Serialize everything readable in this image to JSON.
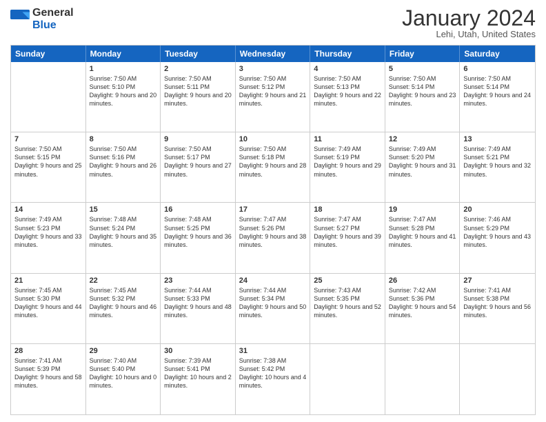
{
  "logo": {
    "general": "General",
    "blue": "Blue"
  },
  "title": "January 2024",
  "location": "Lehi, Utah, United States",
  "days": [
    "Sunday",
    "Monday",
    "Tuesday",
    "Wednesday",
    "Thursday",
    "Friday",
    "Saturday"
  ],
  "weeks": [
    [
      {
        "num": "",
        "sunrise": "",
        "sunset": "",
        "daylight": ""
      },
      {
        "num": "1",
        "sunrise": "Sunrise: 7:50 AM",
        "sunset": "Sunset: 5:10 PM",
        "daylight": "Daylight: 9 hours and 20 minutes."
      },
      {
        "num": "2",
        "sunrise": "Sunrise: 7:50 AM",
        "sunset": "Sunset: 5:11 PM",
        "daylight": "Daylight: 9 hours and 20 minutes."
      },
      {
        "num": "3",
        "sunrise": "Sunrise: 7:50 AM",
        "sunset": "Sunset: 5:12 PM",
        "daylight": "Daylight: 9 hours and 21 minutes."
      },
      {
        "num": "4",
        "sunrise": "Sunrise: 7:50 AM",
        "sunset": "Sunset: 5:13 PM",
        "daylight": "Daylight: 9 hours and 22 minutes."
      },
      {
        "num": "5",
        "sunrise": "Sunrise: 7:50 AM",
        "sunset": "Sunset: 5:14 PM",
        "daylight": "Daylight: 9 hours and 23 minutes."
      },
      {
        "num": "6",
        "sunrise": "Sunrise: 7:50 AM",
        "sunset": "Sunset: 5:14 PM",
        "daylight": "Daylight: 9 hours and 24 minutes."
      }
    ],
    [
      {
        "num": "7",
        "sunrise": "Sunrise: 7:50 AM",
        "sunset": "Sunset: 5:15 PM",
        "daylight": "Daylight: 9 hours and 25 minutes."
      },
      {
        "num": "8",
        "sunrise": "Sunrise: 7:50 AM",
        "sunset": "Sunset: 5:16 PM",
        "daylight": "Daylight: 9 hours and 26 minutes."
      },
      {
        "num": "9",
        "sunrise": "Sunrise: 7:50 AM",
        "sunset": "Sunset: 5:17 PM",
        "daylight": "Daylight: 9 hours and 27 minutes."
      },
      {
        "num": "10",
        "sunrise": "Sunrise: 7:50 AM",
        "sunset": "Sunset: 5:18 PM",
        "daylight": "Daylight: 9 hours and 28 minutes."
      },
      {
        "num": "11",
        "sunrise": "Sunrise: 7:49 AM",
        "sunset": "Sunset: 5:19 PM",
        "daylight": "Daylight: 9 hours and 29 minutes."
      },
      {
        "num": "12",
        "sunrise": "Sunrise: 7:49 AM",
        "sunset": "Sunset: 5:20 PM",
        "daylight": "Daylight: 9 hours and 31 minutes."
      },
      {
        "num": "13",
        "sunrise": "Sunrise: 7:49 AM",
        "sunset": "Sunset: 5:21 PM",
        "daylight": "Daylight: 9 hours and 32 minutes."
      }
    ],
    [
      {
        "num": "14",
        "sunrise": "Sunrise: 7:49 AM",
        "sunset": "Sunset: 5:23 PM",
        "daylight": "Daylight: 9 hours and 33 minutes."
      },
      {
        "num": "15",
        "sunrise": "Sunrise: 7:48 AM",
        "sunset": "Sunset: 5:24 PM",
        "daylight": "Daylight: 9 hours and 35 minutes."
      },
      {
        "num": "16",
        "sunrise": "Sunrise: 7:48 AM",
        "sunset": "Sunset: 5:25 PM",
        "daylight": "Daylight: 9 hours and 36 minutes."
      },
      {
        "num": "17",
        "sunrise": "Sunrise: 7:47 AM",
        "sunset": "Sunset: 5:26 PM",
        "daylight": "Daylight: 9 hours and 38 minutes."
      },
      {
        "num": "18",
        "sunrise": "Sunrise: 7:47 AM",
        "sunset": "Sunset: 5:27 PM",
        "daylight": "Daylight: 9 hours and 39 minutes."
      },
      {
        "num": "19",
        "sunrise": "Sunrise: 7:47 AM",
        "sunset": "Sunset: 5:28 PM",
        "daylight": "Daylight: 9 hours and 41 minutes."
      },
      {
        "num": "20",
        "sunrise": "Sunrise: 7:46 AM",
        "sunset": "Sunset: 5:29 PM",
        "daylight": "Daylight: 9 hours and 43 minutes."
      }
    ],
    [
      {
        "num": "21",
        "sunrise": "Sunrise: 7:45 AM",
        "sunset": "Sunset: 5:30 PM",
        "daylight": "Daylight: 9 hours and 44 minutes."
      },
      {
        "num": "22",
        "sunrise": "Sunrise: 7:45 AM",
        "sunset": "Sunset: 5:32 PM",
        "daylight": "Daylight: 9 hours and 46 minutes."
      },
      {
        "num": "23",
        "sunrise": "Sunrise: 7:44 AM",
        "sunset": "Sunset: 5:33 PM",
        "daylight": "Daylight: 9 hours and 48 minutes."
      },
      {
        "num": "24",
        "sunrise": "Sunrise: 7:44 AM",
        "sunset": "Sunset: 5:34 PM",
        "daylight": "Daylight: 9 hours and 50 minutes."
      },
      {
        "num": "25",
        "sunrise": "Sunrise: 7:43 AM",
        "sunset": "Sunset: 5:35 PM",
        "daylight": "Daylight: 9 hours and 52 minutes."
      },
      {
        "num": "26",
        "sunrise": "Sunrise: 7:42 AM",
        "sunset": "Sunset: 5:36 PM",
        "daylight": "Daylight: 9 hours and 54 minutes."
      },
      {
        "num": "27",
        "sunrise": "Sunrise: 7:41 AM",
        "sunset": "Sunset: 5:38 PM",
        "daylight": "Daylight: 9 hours and 56 minutes."
      }
    ],
    [
      {
        "num": "28",
        "sunrise": "Sunrise: 7:41 AM",
        "sunset": "Sunset: 5:39 PM",
        "daylight": "Daylight: 9 hours and 58 minutes."
      },
      {
        "num": "29",
        "sunrise": "Sunrise: 7:40 AM",
        "sunset": "Sunset: 5:40 PM",
        "daylight": "Daylight: 10 hours and 0 minutes."
      },
      {
        "num": "30",
        "sunrise": "Sunrise: 7:39 AM",
        "sunset": "Sunset: 5:41 PM",
        "daylight": "Daylight: 10 hours and 2 minutes."
      },
      {
        "num": "31",
        "sunrise": "Sunrise: 7:38 AM",
        "sunset": "Sunset: 5:42 PM",
        "daylight": "Daylight: 10 hours and 4 minutes."
      },
      {
        "num": "",
        "sunrise": "",
        "sunset": "",
        "daylight": ""
      },
      {
        "num": "",
        "sunrise": "",
        "sunset": "",
        "daylight": ""
      },
      {
        "num": "",
        "sunrise": "",
        "sunset": "",
        "daylight": ""
      }
    ]
  ]
}
